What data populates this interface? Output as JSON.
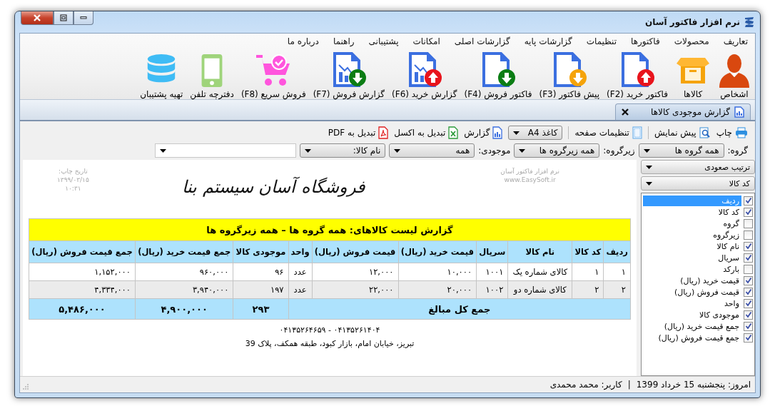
{
  "window": {
    "title": "نرم افزار فاکتور آسان"
  },
  "menu": [
    "تعاریف",
    "محصولات",
    "فاکتورها",
    "تنظیمات",
    "گزارشات پایه",
    "گزارشات اصلی",
    "امکانات",
    "پشتیبانی",
    "راهنما",
    "درباره ما"
  ],
  "toolbar": [
    {
      "label": "اشخاص",
      "kind": "person"
    },
    {
      "label": "کالاها",
      "kind": "box"
    },
    {
      "label": "فاکتور خرید (F2)",
      "kind": "docup",
      "color": "#e8141c"
    },
    {
      "label": "پیش فاکتور (F3)",
      "kind": "docdown",
      "color": "#f5a30a"
    },
    {
      "label": "فاکتور فروش (F4)",
      "kind": "docdown",
      "color": "#0b7d14"
    },
    {
      "label": "گزارش خرید (F6)",
      "kind": "reportup",
      "color": "#e8141c"
    },
    {
      "label": "گزارش فروش (F7)",
      "kind": "reportdown",
      "color": "#0b7d14"
    },
    {
      "label": "فروش سریع (F8)",
      "kind": "cart"
    },
    {
      "label": "دفترچه تلفن",
      "kind": "phone"
    },
    {
      "label": "تهیه پشتیبان",
      "kind": "database"
    }
  ],
  "tabs": [
    {
      "label": "گزارش موجودی کالاها",
      "selected": true
    }
  ],
  "report_toolbar": [
    {
      "label": "چاپ",
      "kind": "print"
    },
    {
      "label": "پیش نمایش",
      "kind": "preview"
    },
    {
      "label": "تنظیمات صفحه",
      "kind": "page"
    },
    {
      "value": "کاغذ A4",
      "kind": "dropdown"
    },
    {
      "label": "گزارش",
      "kind": "report"
    },
    {
      "label": "تبدیل به اکسل",
      "kind": "excel"
    },
    {
      "label": "تبدیل به PDF",
      "kind": "pdf"
    }
  ],
  "filters": [
    {
      "label": "گروه:",
      "value": "همه گروه ها"
    },
    {
      "label": "زیرگروه:",
      "value": "همه زیرگروه ها"
    },
    {
      "label": "موجودی:",
      "value": "همه"
    },
    {
      "value": "نام کالا:"
    }
  ],
  "report": {
    "software": "نرم افزار فاکتور آسان",
    "website": "www.EasySoft.ir",
    "store_name": "فروشگاه آسان سیستم بنا",
    "print_date_label": "تاریخ چاپ:",
    "print_date": "۱۳۹۹/۰۳/۱۵",
    "print_time": "۱۰:۳۱",
    "table": {
      "title": "گزارش لیست کالاهای: همه گروه ها – همه زیرگروه ها",
      "columns": [
        "ردیف",
        "کد کالا",
        "نام کالا",
        "سریال",
        "قیمت خرید (ریال)",
        "قیمت فروش (ریال)",
        "واحد",
        "موجودی کالا",
        "جمع قیمت خرید (ریال)",
        "جمع قیمت فروش (ریال)"
      ],
      "rows": [
        [
          "۱",
          "۱",
          "کالای شماره یک",
          "۱۰۰۱",
          "۱۰,۰۰۰",
          "۱۲,۰۰۰",
          "عدد",
          "۹۶",
          "۹۶۰,۰۰۰",
          "۱,۱۵۲,۰۰۰"
        ],
        [
          "۲",
          "۲",
          "کالای شماره دو",
          "۱۰۰۲",
          "۲۰,۰۰۰",
          "۲۲,۰۰۰",
          "عدد",
          "۱۹۷",
          "۳,۹۴۰,۰۰۰",
          "۴,۳۳۴,۰۰۰"
        ]
      ],
      "total_label": "جمع کل مبالغ",
      "totals": [
        "۲۹۳",
        "۴,۹۰۰,۰۰۰",
        "۵,۴۸۶,۰۰۰"
      ]
    },
    "phones": "۰۴۱۳۵۲۶۱۴۰۴ - ۰۴۱۳۵۲۶۴۶۵۹",
    "address": "تبریز، خیابان امام، بازار کبود، طبقه همکف، پلاک 39"
  },
  "side_panel": {
    "sort_order": "ترتیب صعودی",
    "sort_field": "کد کالا",
    "fields": [
      {
        "label": "ردیف",
        "checked": true,
        "selected": true
      },
      {
        "label": "کد کالا",
        "checked": true,
        "selected": false
      },
      {
        "label": "گروه",
        "checked": false,
        "selected": false
      },
      {
        "label": "زیرگروه",
        "checked": false,
        "selected": false
      },
      {
        "label": "نام کالا",
        "checked": true,
        "selected": false
      },
      {
        "label": "سریال",
        "checked": true,
        "selected": false
      },
      {
        "label": "بارکد",
        "checked": false,
        "selected": false
      },
      {
        "label": "قیمت خرید (ریال)",
        "checked": true,
        "selected": false
      },
      {
        "label": "قیمت فروش (ریال)",
        "checked": true,
        "selected": false
      },
      {
        "label": "واحد",
        "checked": true,
        "selected": false
      },
      {
        "label": "موجودی کالا",
        "checked": true,
        "selected": false
      },
      {
        "label": "جمع قیمت خرید (ریال)",
        "checked": true,
        "selected": false
      },
      {
        "label": "جمع قیمت فروش (ریال)",
        "checked": true,
        "selected": false
      }
    ]
  },
  "status_bar": {
    "date": "امروز: پنجشنبه 15 خرداد 1399",
    "separator": "|",
    "user": "کاربر: محمد محمدی"
  }
}
